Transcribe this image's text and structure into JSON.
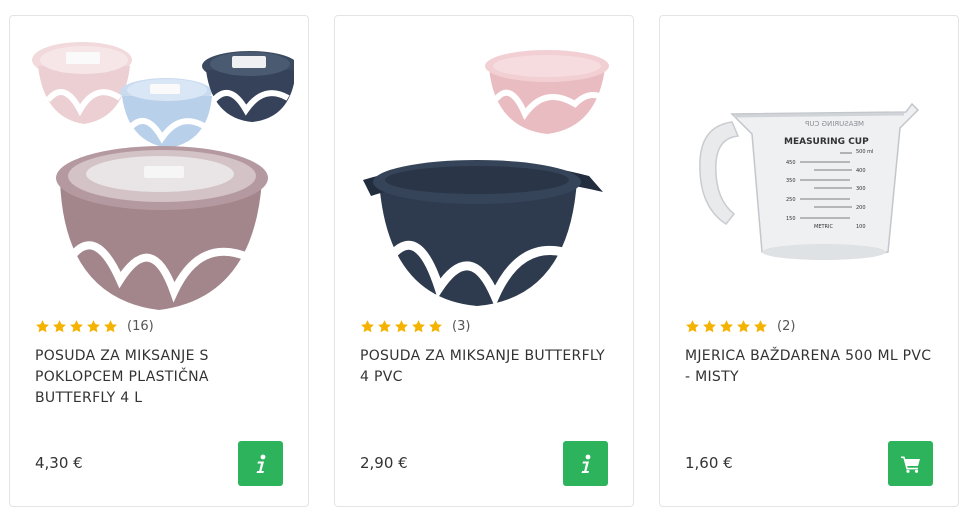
{
  "colors": {
    "star": "#f5b301",
    "button": "#2db35c",
    "border": "#e4e4e4"
  },
  "products": [
    {
      "name": "POSUDA ZA MIKSANJE S POKLOPCEM PLASTIČNA BUTTERFLY 4 L",
      "rating_count": "(16)",
      "rating": 5,
      "price": "4,30 €",
      "action_icon": "info-icon"
    },
    {
      "name": "POSUDA ZA MIKSANJE BUTTERFLY 4 PVC",
      "rating_count": "(3)",
      "rating": 5,
      "price": "2,90 €",
      "action_icon": "info-icon"
    },
    {
      "name": "MJERICA BAŽDARENA 500 mL PVC - MISTY",
      "rating_count": "(2)",
      "rating": 5,
      "price": "1,60 €",
      "action_icon": "cart-icon"
    }
  ],
  "measuring_cup": {
    "label": "MEASURING CUP",
    "mirror_label": "MEASURING CUP",
    "unit_top": "500 ml",
    "left_marks": [
      "450",
      "350",
      "250",
      "150"
    ],
    "right_marks": [
      "400",
      "300",
      "200",
      "100"
    ],
    "metric": "METRIC"
  }
}
